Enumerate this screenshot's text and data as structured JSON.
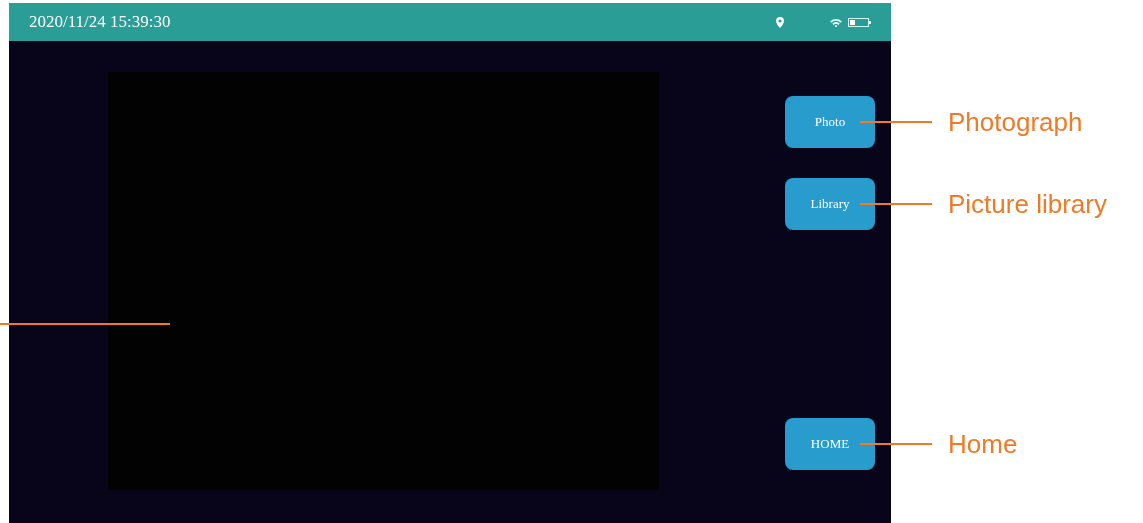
{
  "status_bar": {
    "datetime": "2020/11/24 15:39:30"
  },
  "buttons": [
    {
      "label": "Photo",
      "callout": "Photograph"
    },
    {
      "label": "Library",
      "callout": "Picture library"
    },
    {
      "label": "HOME",
      "callout": "Home"
    }
  ]
}
